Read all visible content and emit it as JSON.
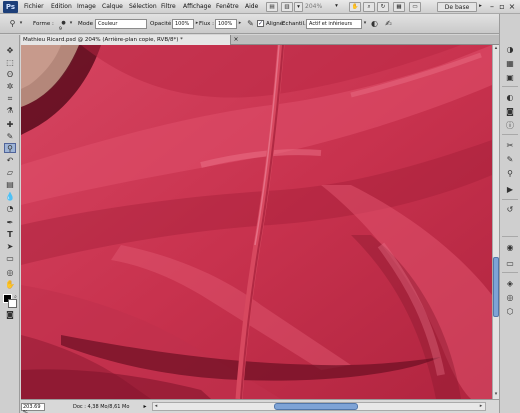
{
  "app": {
    "logo": "Ps",
    "menus": [
      "Fichier",
      "Edition",
      "Image",
      "Calque",
      "Sélection",
      "Filtre",
      "Affichage",
      "Fenêtre",
      "Aide"
    ],
    "zoom": "204%",
    "workspace": "De base"
  },
  "options": {
    "forme_label": "Forme :",
    "brush_size": "9",
    "mode_label": "Mode :",
    "mode_value": "Couleur",
    "opacity_label": "Opacité :",
    "opacity_value": "100%",
    "flux_label": "Flux :",
    "flux_value": "100%",
    "aligned_label": "Aligné",
    "aligned_checked": true,
    "sample_label": "Echantil. :",
    "sample_value": "Actif et inférieurs"
  },
  "document": {
    "tab_title": "Mathieu Ricard.psd @ 204% (Arrière-plan copie, RVB/8*) *",
    "close": "×"
  },
  "status": {
    "zoom": "203.69 %",
    "doc_size": "Doc : 4,38 Mo/8,61 Mo"
  },
  "colors": {
    "fabric": "#c8334e",
    "foreground": "#000000",
    "background": "#ffffff",
    "scroll_accent": "#7ea3d6"
  },
  "icons": {
    "tools": [
      "move-icon",
      "marquee-icon",
      "lasso-icon",
      "magic-wand-icon",
      "crop-icon",
      "eyedropper-icon",
      "healing-brush-icon",
      "brush-icon",
      "clone-stamp-icon",
      "history-brush-icon",
      "eraser-icon",
      "gradient-icon",
      "blur-icon",
      "dodge-icon",
      "pen-icon",
      "type-icon",
      "path-select-icon",
      "shape-icon",
      "hand-icon",
      "zoom-icon"
    ],
    "dock": [
      "color-panel-icon",
      "swatches-icon",
      "styles-icon",
      "adjustments-icon",
      "masks-icon",
      "tools-panel-icon",
      "brush-panel-icon",
      "clone-source-icon",
      "channels-icon",
      "paths-icon",
      "layers-icon",
      "3d-icon"
    ]
  }
}
